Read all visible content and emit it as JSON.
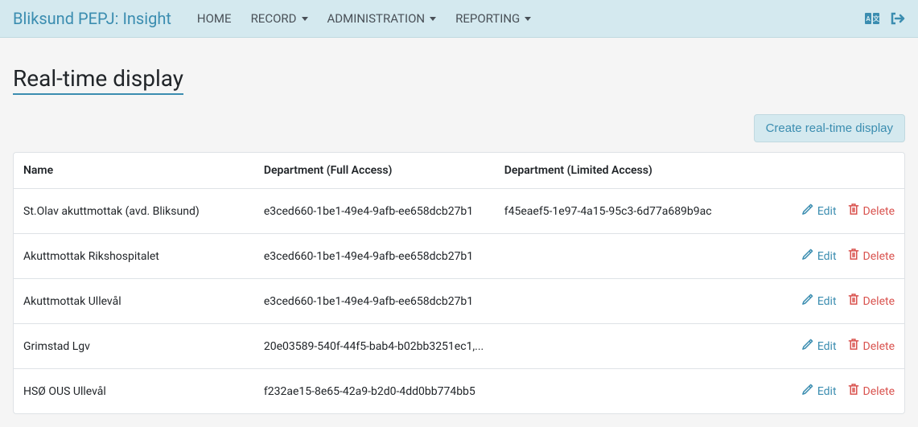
{
  "nav": {
    "brand": "Bliksund PEPJ: Insight",
    "items": [
      {
        "label": "HOME",
        "dropdown": false
      },
      {
        "label": "RECORD",
        "dropdown": true
      },
      {
        "label": "ADMINISTRATION",
        "dropdown": true
      },
      {
        "label": "REPORTING",
        "dropdown": true
      }
    ]
  },
  "page": {
    "title": "Real-time display",
    "create_label": "Create real-time display"
  },
  "table": {
    "headers": {
      "name": "Name",
      "full": "Department (Full Access)",
      "limited": "Department (Limited Access)"
    },
    "actions": {
      "edit": "Edit",
      "delete": "Delete"
    },
    "rows": [
      {
        "name": "St.Olav akuttmottak (avd. Bliksund)",
        "full": "e3ced660-1be1-49e4-9afb-ee658dcb27b1",
        "limited": "f45eaef5-1e97-4a15-95c3-6d77a689b9ac"
      },
      {
        "name": "Akuttmottak Rikshospitalet",
        "full": "e3ced660-1be1-49e4-9afb-ee658dcb27b1",
        "limited": ""
      },
      {
        "name": "Akuttmottak Ullevål",
        "full": "e3ced660-1be1-49e4-9afb-ee658dcb27b1",
        "limited": ""
      },
      {
        "name": "Grimstad Lgv",
        "full": "20e03589-540f-44f5-bab4-b02bb3251ec1,...",
        "limited": ""
      },
      {
        "name": "HSØ OUS Ullevål",
        "full": "f232ae15-8e65-42a9-b2d0-4dd0bb774bb5",
        "limited": ""
      }
    ]
  }
}
